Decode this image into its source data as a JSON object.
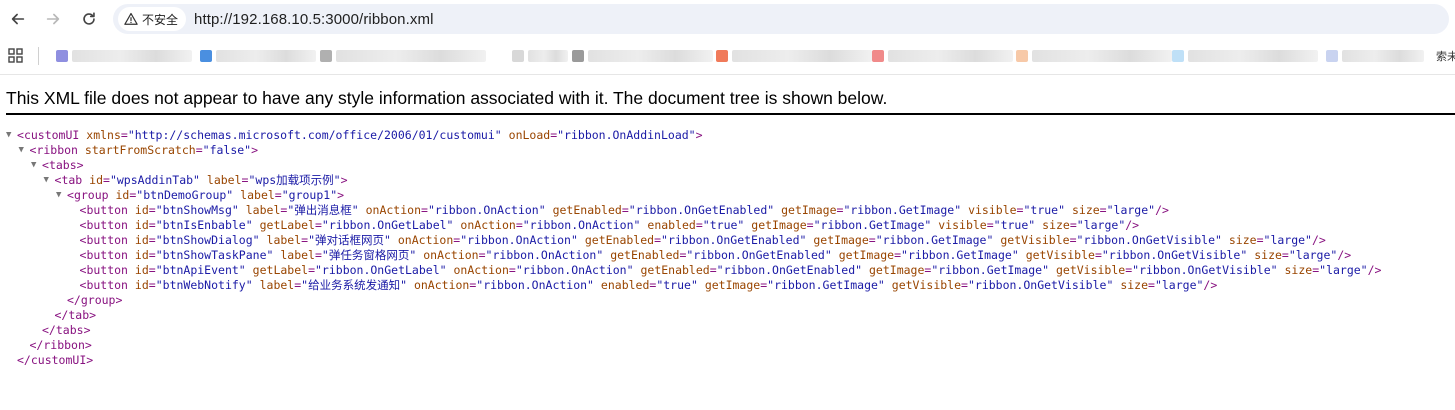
{
  "browser": {
    "security_label": "不安全",
    "url": "http://192.168.10.5:3000/ribbon.xml",
    "bookmarks_overflow_label": "索未"
  },
  "xml_viewer": {
    "banner": "This XML file does not appear to have any style information associated with it. The document tree is shown below."
  },
  "xml": {
    "lines": [
      {
        "indent": 0,
        "fold": true,
        "text": "<customUI xmlns=\"http://schemas.microsoft.com/office/2006/01/customui\" onLoad=\"ribbon.OnAddinLoad\">"
      },
      {
        "indent": 1,
        "fold": true,
        "text": "<ribbon startFromScratch=\"false\">"
      },
      {
        "indent": 2,
        "fold": true,
        "text": "<tabs>"
      },
      {
        "indent": 3,
        "fold": true,
        "text": "<tab id=\"wpsAddinTab\" label=\"wps加载项示例\">"
      },
      {
        "indent": 4,
        "fold": true,
        "text": "<group id=\"btnDemoGroup\" label=\"group1\">"
      },
      {
        "indent": 5,
        "fold": false,
        "text": "<button id=\"btnShowMsg\" label=\"弹出消息框\" onAction=\"ribbon.OnAction\" getEnabled=\"ribbon.OnGetEnabled\" getImage=\"ribbon.GetImage\" visible=\"true\" size=\"large\"/>"
      },
      {
        "indent": 5,
        "fold": false,
        "text": "<button id=\"btnIsEnbable\" getLabel=\"ribbon.OnGetLabel\" onAction=\"ribbon.OnAction\" enabled=\"true\" getImage=\"ribbon.GetImage\" visible=\"true\" size=\"large\"/>"
      },
      {
        "indent": 5,
        "fold": false,
        "text": "<button id=\"btnShowDialog\" label=\"弹对话框网页\" onAction=\"ribbon.OnAction\" getEnabled=\"ribbon.OnGetEnabled\" getImage=\"ribbon.GetImage\" getVisible=\"ribbon.OnGetVisible\" size=\"large\"/>"
      },
      {
        "indent": 5,
        "fold": false,
        "text": "<button id=\"btnShowTaskPane\" label=\"弹任务窗格网页\" onAction=\"ribbon.OnAction\" getEnabled=\"ribbon.OnGetEnabled\" getImage=\"ribbon.GetImage\" getVisible=\"ribbon.OnGetVisible\" size=\"large\"/>"
      },
      {
        "indent": 5,
        "fold": false,
        "text": "<button id=\"btnApiEvent\" getLabel=\"ribbon.OnGetLabel\" onAction=\"ribbon.OnAction\" getEnabled=\"ribbon.OnGetEnabled\" getImage=\"ribbon.GetImage\" getVisible=\"ribbon.OnGetVisible\" size=\"large\"/>"
      },
      {
        "indent": 5,
        "fold": false,
        "text": "<button id=\"btnWebNotify\" label=\"给业务系统发通知\" onAction=\"ribbon.OnAction\" enabled=\"true\" getImage=\"ribbon.GetImage\" getVisible=\"ribbon.OnGetVisible\" size=\"large\"/>"
      },
      {
        "indent": 4,
        "fold": false,
        "text": "</group>"
      },
      {
        "indent": 3,
        "fold": false,
        "text": "</tab>"
      },
      {
        "indent": 2,
        "fold": false,
        "text": "</tabs>"
      },
      {
        "indent": 1,
        "fold": false,
        "text": "</ribbon>"
      },
      {
        "indent": 0,
        "fold": false,
        "text": "</customUI>"
      }
    ]
  }
}
